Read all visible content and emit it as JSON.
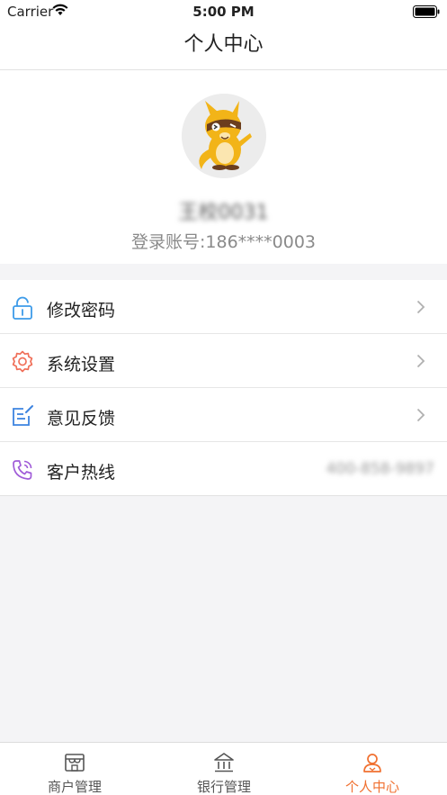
{
  "status_bar": {
    "carrier": "Carrier",
    "time": "5:00 PM"
  },
  "nav": {
    "title": "个人中心"
  },
  "profile": {
    "username": "王校0031",
    "account_line": "登录账号:186****0003"
  },
  "menu": {
    "items": [
      {
        "label": "修改密码",
        "icon": "lock-icon",
        "color": "#3d9be9"
      },
      {
        "label": "系统设置",
        "icon": "gear-icon",
        "color": "#f0705a"
      },
      {
        "label": "意见反馈",
        "icon": "feedback-icon",
        "color": "#3d84e0"
      },
      {
        "label": "客户热线",
        "icon": "phone-icon",
        "color": "#a05cd8",
        "value": "400-858-9897"
      }
    ]
  },
  "tabs": [
    {
      "label": "商户管理",
      "icon": "store-icon"
    },
    {
      "label": "银行管理",
      "icon": "bank-icon"
    },
    {
      "label": "个人中心",
      "icon": "person-icon",
      "active": true
    }
  ],
  "colors": {
    "accent": "#f07030",
    "background": "#f4f4f6"
  }
}
